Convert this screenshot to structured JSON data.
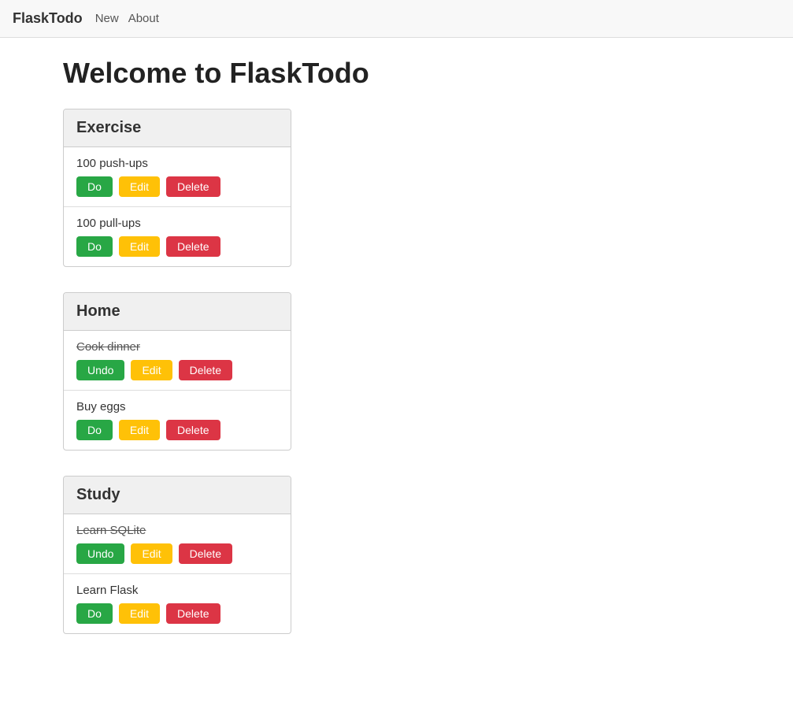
{
  "nav": {
    "brand": "FlaskTodo",
    "links": [
      {
        "label": "New",
        "name": "nav-new"
      },
      {
        "label": "About",
        "name": "nav-about"
      }
    ]
  },
  "page": {
    "title": "Welcome to FlaskTodo"
  },
  "categories": [
    {
      "name": "Exercise",
      "tasks": [
        {
          "text": "100 push-ups",
          "completed": false,
          "action": "Do"
        },
        {
          "text": "100 pull-ups",
          "completed": false,
          "action": "Do"
        }
      ]
    },
    {
      "name": "Home",
      "tasks": [
        {
          "text": "Cook dinner",
          "completed": true,
          "action": "Undo"
        },
        {
          "text": "Buy eggs",
          "completed": false,
          "action": "Do"
        }
      ]
    },
    {
      "name": "Study",
      "tasks": [
        {
          "text": "Learn SQLite",
          "completed": true,
          "action": "Undo"
        },
        {
          "text": "Learn Flask",
          "completed": false,
          "action": "Do"
        }
      ]
    }
  ],
  "buttons": {
    "edit": "Edit",
    "delete": "Delete"
  }
}
